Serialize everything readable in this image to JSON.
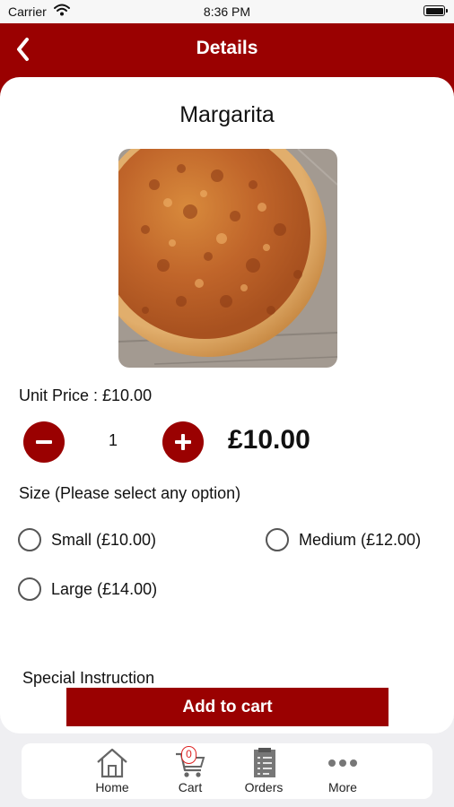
{
  "status_bar": {
    "carrier": "Carrier",
    "time": "8:36 PM"
  },
  "nav": {
    "title": "Details"
  },
  "product": {
    "name": "Margarita",
    "unit_price_text": "Unit Price : £10.00",
    "quantity": "1",
    "total_price": "£10.00"
  },
  "size": {
    "label": "Size (Please select any option)",
    "options": [
      {
        "label": "Small (£10.00)",
        "selected": false
      },
      {
        "label": "Medium (£12.00)",
        "selected": false
      },
      {
        "label": "Large (£14.00)",
        "selected": false
      }
    ]
  },
  "special_instruction": {
    "label": "Special Instruction"
  },
  "add_to_cart": {
    "label": "Add to cart"
  },
  "tabs": [
    {
      "label": "Home",
      "icon": "home-icon"
    },
    {
      "label": "Cart",
      "icon": "cart-icon",
      "badge": "0"
    },
    {
      "label": "Orders",
      "icon": "orders-icon"
    },
    {
      "label": "More",
      "icon": "more-icon"
    }
  ],
  "colors": {
    "brand": "#9a0101",
    "background": "#efeff2",
    "badge": "#d22222"
  }
}
